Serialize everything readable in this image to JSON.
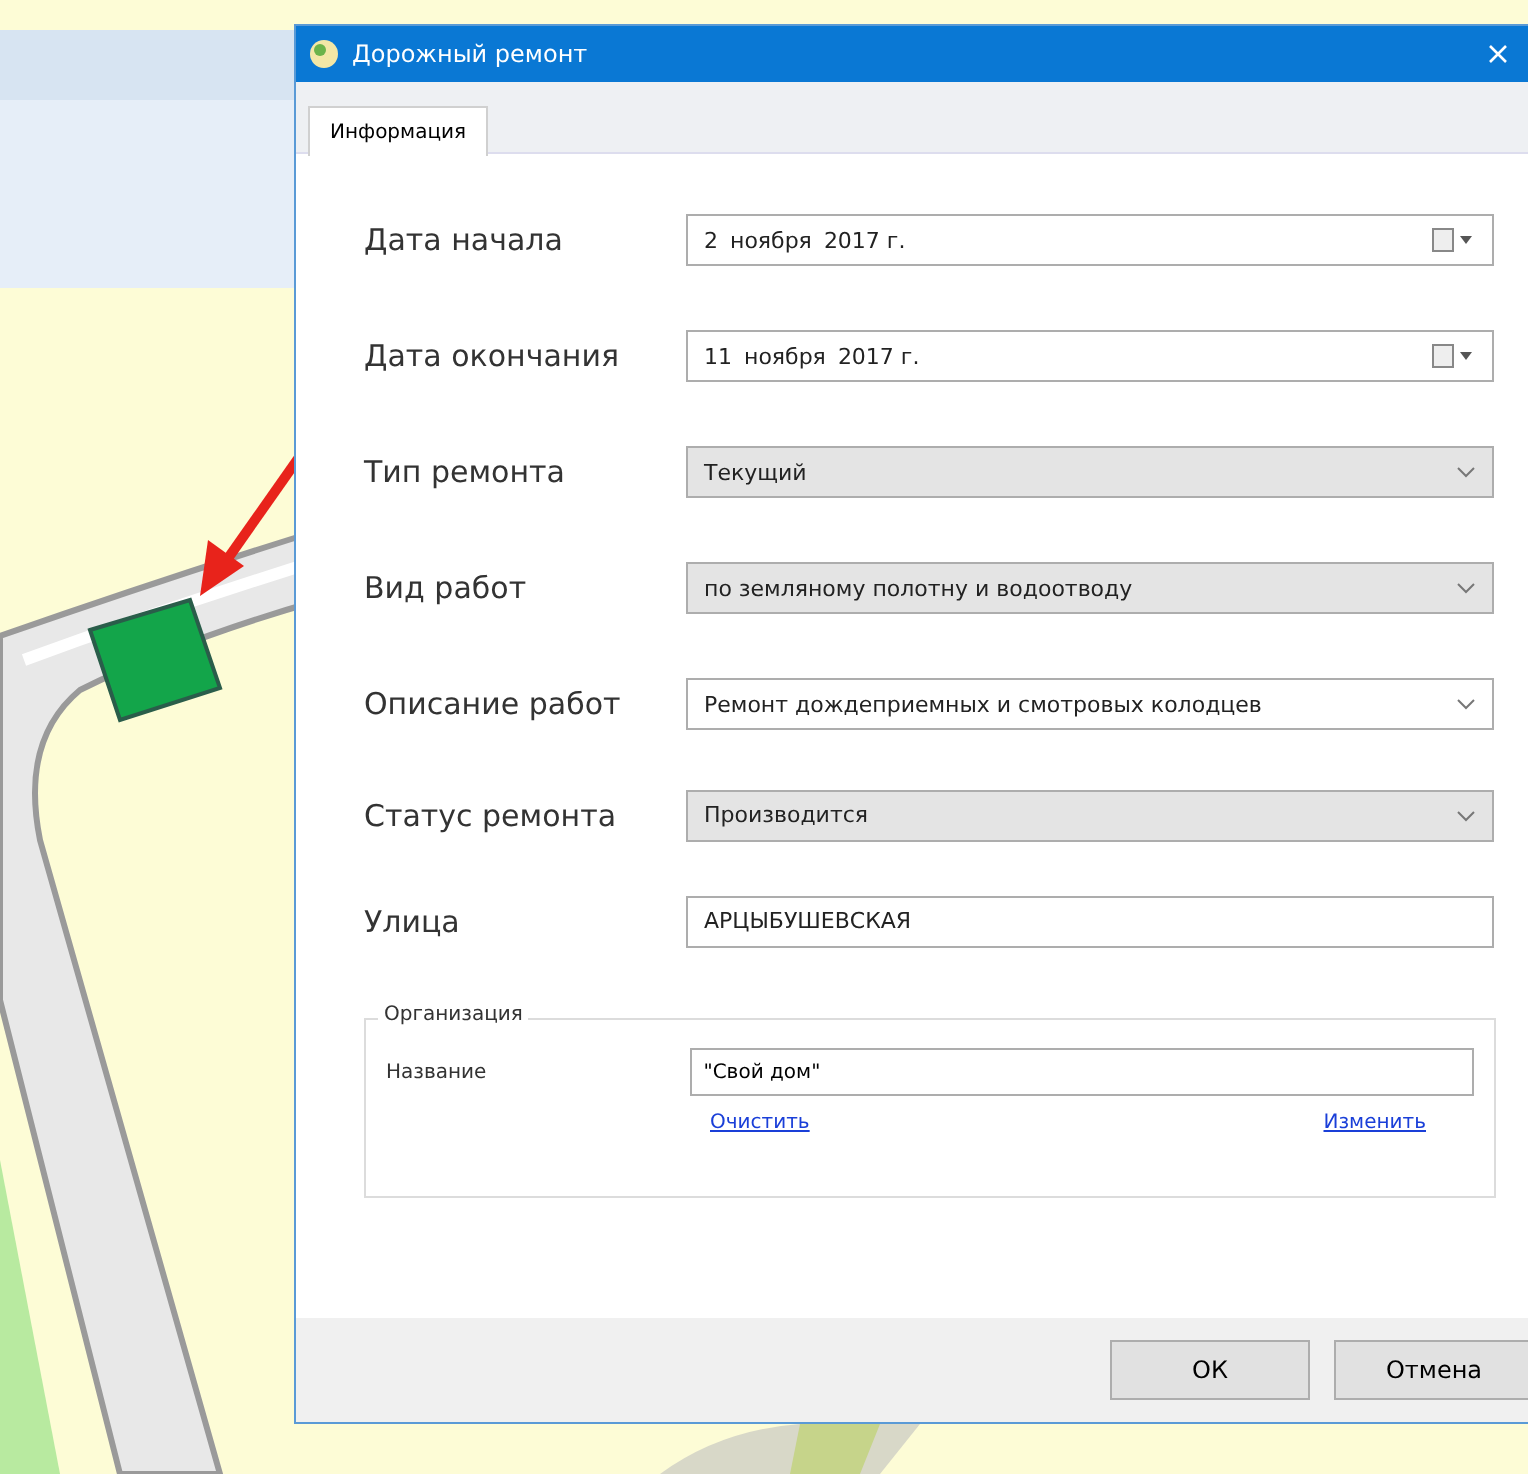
{
  "window": {
    "title": "Дорожный ремонт"
  },
  "tabs": [
    {
      "label": "Информация",
      "selected": true
    }
  ],
  "fields": [
    {
      "label": "Дата начала",
      "kind": "date",
      "day": "2",
      "month": "ноября",
      "year": "2017 г."
    },
    {
      "label": "Дата окончания",
      "kind": "date",
      "day": "11",
      "month": "ноября",
      "year": "2017 г."
    },
    {
      "label": "Тип ремонта",
      "kind": "list",
      "value": "Текущий"
    },
    {
      "label": "Вид работ",
      "kind": "list",
      "value": "по земляному полотну и водоотводу"
    },
    {
      "label": "Описание работ",
      "kind": "combo",
      "value": "Ремонт дождеприемных и смотровых колодцев"
    },
    {
      "label": "Статус ремонта",
      "kind": "list",
      "value": "Производится"
    },
    {
      "label": "Улица",
      "kind": "text",
      "value": "АРЦЫБУШЕВСКАЯ"
    }
  ],
  "organization": {
    "title": "Организация",
    "label": "Название",
    "value": "\"Свой дом\"",
    "links": [
      "Очистить",
      "Изменить"
    ]
  },
  "buttons": [
    "ОК",
    "Отмена"
  ]
}
